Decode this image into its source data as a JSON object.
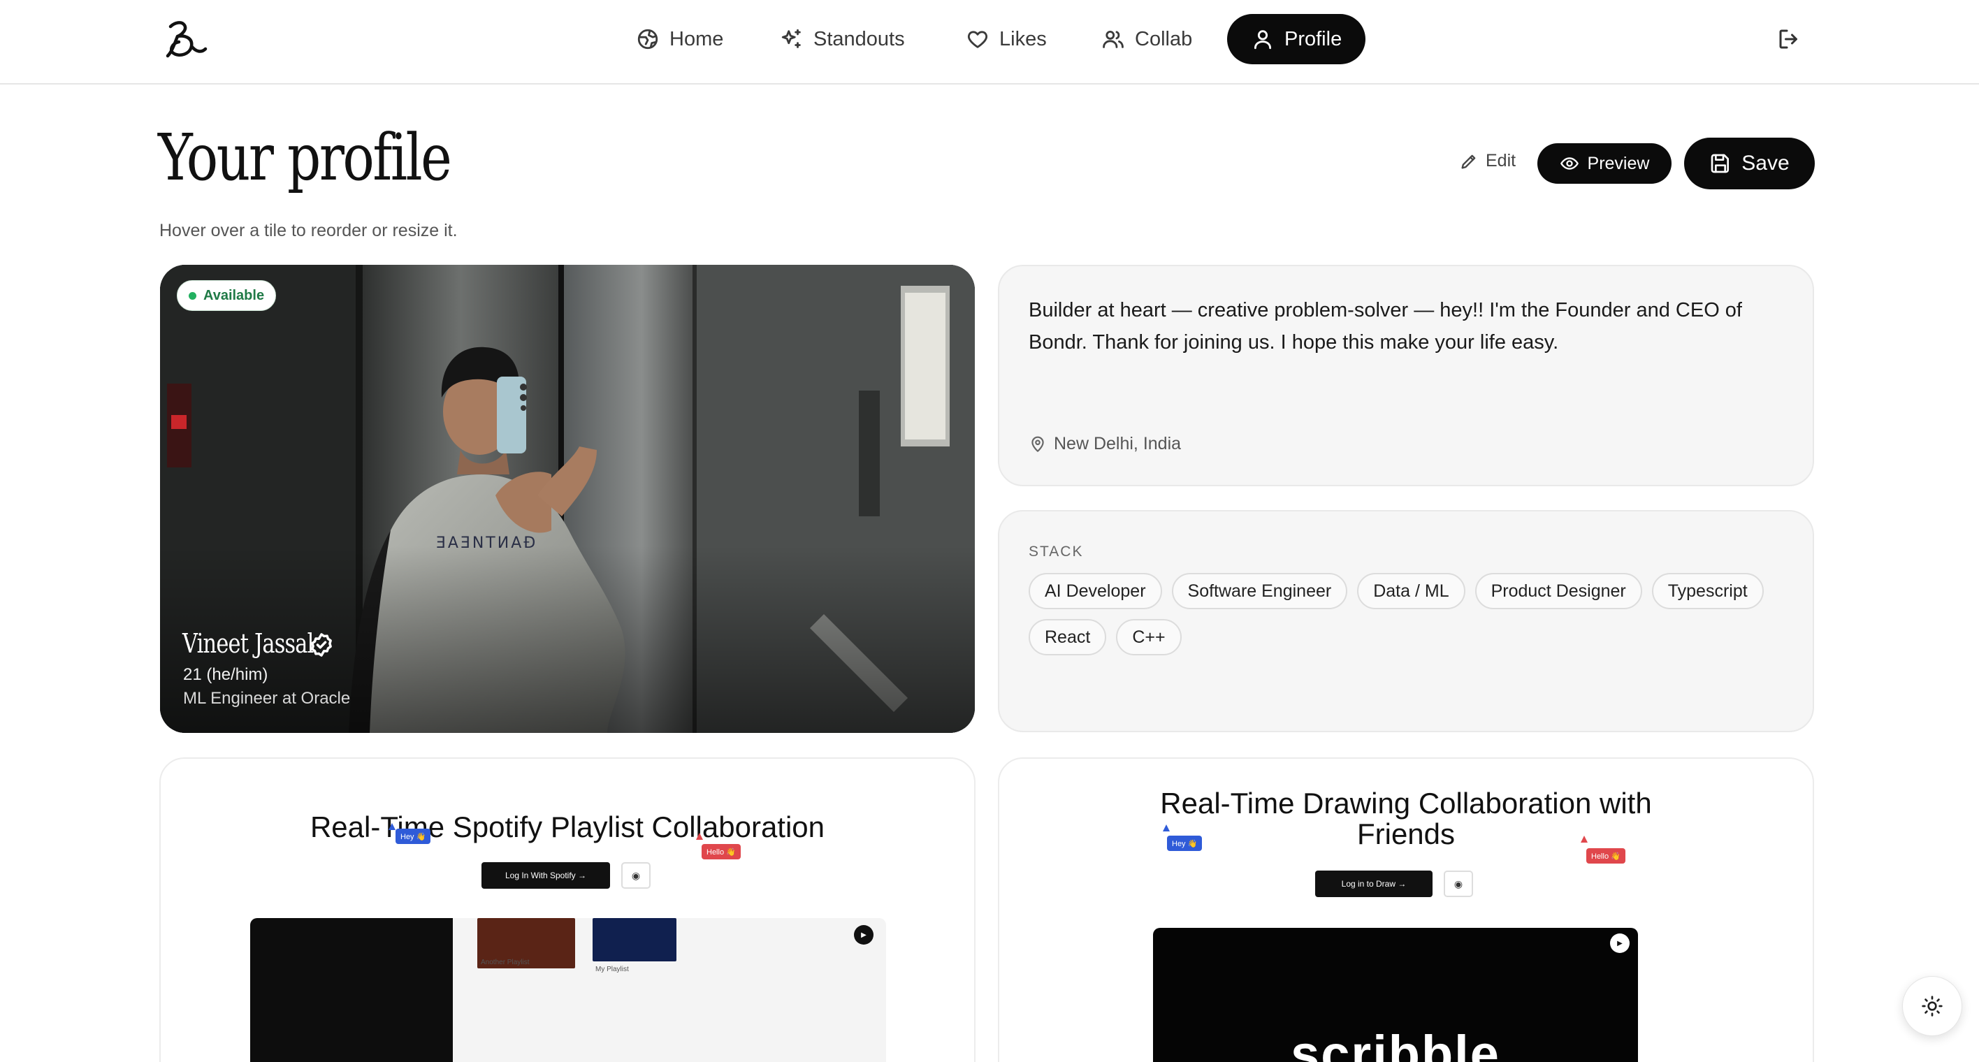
{
  "nav": {
    "items": [
      {
        "label": "Home",
        "icon": "home-globe-icon"
      },
      {
        "label": "Standouts",
        "icon": "sparkles-icon"
      },
      {
        "label": "Likes",
        "icon": "heart-icon"
      },
      {
        "label": "Collab",
        "icon": "users-icon"
      },
      {
        "label": "Profile",
        "icon": "user-icon",
        "active": true
      }
    ]
  },
  "header": {
    "title": "Your profile",
    "subtitle": "Hover over a tile to reorder or resize it.",
    "edit_label": "Edit",
    "preview_label": "Preview",
    "save_label": "Save"
  },
  "profile": {
    "status": "Available",
    "name": "Vineet Jassal",
    "age_pronouns": "21 (he/him)",
    "job": "ML Engineer at Oracle",
    "bio": "Builder at heart — creative problem-solver — hey!! I'm the Founder and CEO of Bondr. Thank for joining us. I hope this make your life easy.",
    "location": "New Delhi, India"
  },
  "stack": {
    "label": "STACK",
    "tags": [
      "AI Developer",
      "Software Engineer",
      "Data / ML",
      "Product Designer",
      "Typescript",
      "React",
      "C++"
    ]
  },
  "projects": [
    {
      "title": "Real-Time Spotify Playlist Collaboration",
      "button": "Log In With Spotify →",
      "cursor_1": "Hey 👋",
      "cursor_2": "Hello 👋",
      "playlist_1": "Another Playlist",
      "playlist_2": "My Playlist"
    },
    {
      "title": "Real-Time Drawing Collaboration with Friends",
      "button": "Log in to Draw →",
      "cursor_1": "Hey 👋",
      "cursor_2": "Hello 👋",
      "preview_word": "scribble"
    }
  ],
  "colors": {
    "accent": "#0b0b0b",
    "available_green": "#22b060",
    "cursor_blue": "#2f5bd8",
    "cursor_red": "#e0474c"
  }
}
